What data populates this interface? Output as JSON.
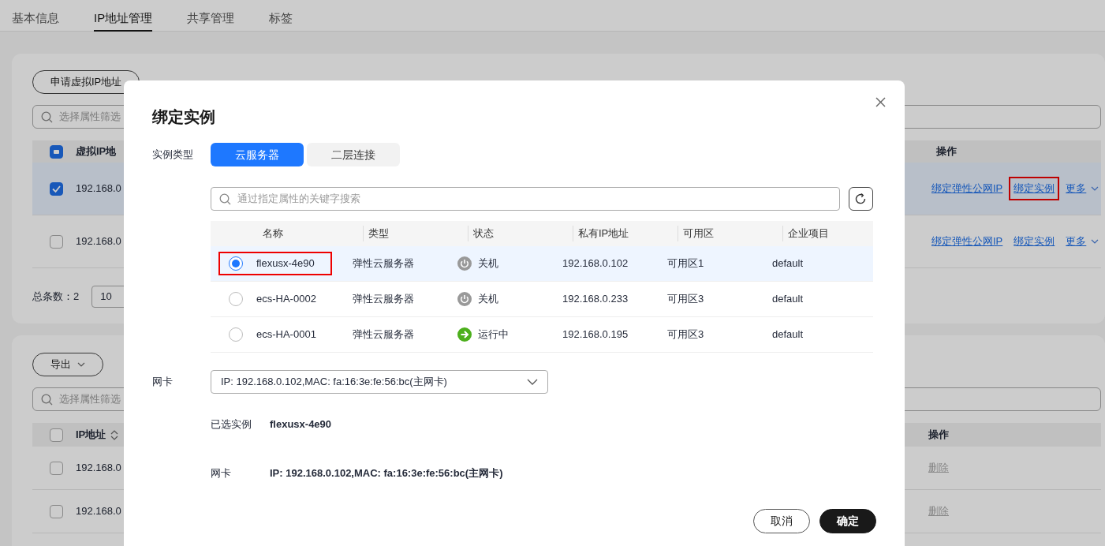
{
  "tabs": [
    {
      "label": "基本信息",
      "selected": false
    },
    {
      "label": "IP地址管理",
      "selected": true
    },
    {
      "label": "共享管理",
      "selected": false
    },
    {
      "label": "标签",
      "selected": false
    }
  ],
  "vip_panel": {
    "apply_button": "申请虚拟IP地址",
    "search": {
      "placeholder": "选择属性筛选"
    },
    "header_checked": true,
    "header_partial": true,
    "columns": [
      "虚拟IP地",
      "操作"
    ],
    "rows": [
      {
        "selected": true,
        "ip": "192.168.0",
        "actions": [
          {
            "label": "绑定弹性公网IP",
            "highlighted": false
          },
          {
            "label": "绑定实例",
            "highlighted": true
          }
        ],
        "more": "更多"
      },
      {
        "selected": false,
        "ip": "192.168.0",
        "actions": [
          {
            "label": "绑定弹性公网IP",
            "highlighted": false
          },
          {
            "label": "绑定实例",
            "highlighted": false
          }
        ],
        "more": "更多"
      }
    ],
    "total": "总条数：2",
    "page_size": "10"
  },
  "ip_panel": {
    "export_button": "导出",
    "search": {
      "placeholder": "选择属性筛选"
    },
    "header_checked": false,
    "columns": [
      "IP地址",
      "操作"
    ],
    "rows": [
      {
        "checked": false,
        "ip": "192.168.0",
        "action": "删除",
        "disabled": true
      },
      {
        "checked": false,
        "ip": "192.168.0",
        "action": "删除",
        "disabled": true
      }
    ]
  },
  "dialog": {
    "title": "绑定实例",
    "type_label": "实例类型",
    "type_options": [
      {
        "label": "云服务器",
        "selected": true
      },
      {
        "label": "二层连接",
        "selected": false
      }
    ],
    "search": {
      "placeholder": "通过指定属性的关键字搜索"
    },
    "columns": [
      "名称",
      "类型",
      "状态",
      "私有IP地址",
      "可用区",
      "企业项目"
    ],
    "rows": [
      {
        "selected": true,
        "highlighted": true,
        "name": "flexusx-4e90",
        "type": "弹性云服务器",
        "status": {
          "kind": "stopped",
          "label": "关机"
        },
        "ip": "192.168.0.102",
        "zone": "可用区1",
        "project": "default"
      },
      {
        "selected": false,
        "highlighted": false,
        "name": "ecs-HA-0002",
        "type": "弹性云服务器",
        "status": {
          "kind": "stopped",
          "label": "关机"
        },
        "ip": "192.168.0.233",
        "zone": "可用区3",
        "project": "default"
      },
      {
        "selected": false,
        "highlighted": false,
        "name": "ecs-HA-0001",
        "type": "弹性云服务器",
        "status": {
          "kind": "running",
          "label": "运行中"
        },
        "ip": "192.168.0.195",
        "zone": "可用区3",
        "project": "default"
      }
    ],
    "nic": {
      "label": "网卡",
      "value": "IP: 192.168.0.102,MAC: fa:16:3e:fe:56:bc(主网卡)"
    },
    "summary": [
      {
        "label": "已选实例",
        "value": "flexusx-4e90"
      },
      {
        "label": "网卡",
        "value": "IP: 192.168.0.102,MAC: fa:16:3e:fe:56:bc(主网卡)"
      }
    ],
    "buttons": [
      {
        "label": "取消",
        "kind": "secondary"
      },
      {
        "label": "确定",
        "kind": "primary"
      }
    ]
  }
}
